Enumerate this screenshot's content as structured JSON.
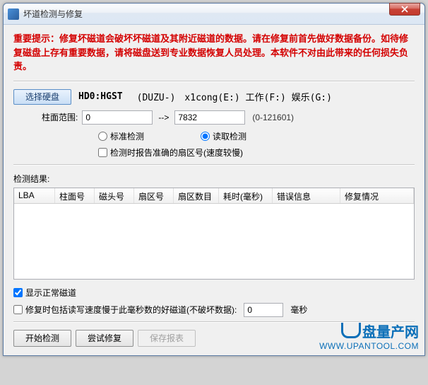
{
  "window": {
    "title": "坏道检测与修复"
  },
  "warning": "重要提示：修复坏磁道会破坏坏磁道及其附近磁道的数据。请在修复前首先做好数据备份。如待修复磁盘上存有重要数据，请将磁盘送到专业数据恢复人员处理。本软件不对由此带来的任何损失负责。",
  "disk": {
    "select_btn": "选择硬盘",
    "model": "HD0:HGST",
    "partitions": "(DUZU-)　x1cong(E:) 工作(F:) 娱乐(G:)"
  },
  "range": {
    "label": "柱面范围:",
    "start": "0",
    "arrow": "-->",
    "end": "7832",
    "hint": "(0-121601)"
  },
  "mode": {
    "standard": "标准检测",
    "read": "读取检测",
    "accurate": "检测时报告准确的扇区号(速度较慢)"
  },
  "results": {
    "label": "检测结果:",
    "headers": [
      "LBA",
      "柱面号",
      "磁头号",
      "扇区号",
      "扇区数目",
      "耗时(毫秒)",
      "错误信息",
      "修复情况"
    ]
  },
  "opts": {
    "show_normal": "显示正常磁道",
    "slow_repair": "修复时包括读写速度慢于此毫秒数的好磁道(不破坏数据):",
    "slow_ms": "0",
    "ms_unit": "毫秒"
  },
  "buttons": {
    "start": "开始检测",
    "repair": "尝试修复",
    "save": "保存报表"
  },
  "watermark": {
    "brand": "盘量产网",
    "url": "WWW.UPANTOOL.COM"
  }
}
